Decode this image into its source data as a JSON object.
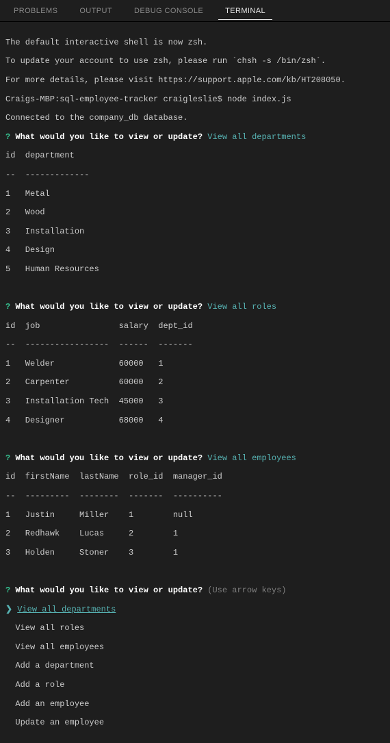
{
  "tabs": {
    "problems": "PROBLEMS",
    "output": "OUTPUT",
    "debug": "DEBUG CONSOLE",
    "terminal": "TERMINAL"
  },
  "intro": {
    "l1": "The default interactive shell is now zsh.",
    "l2a": "To update your account to use zsh, please run ",
    "l2cmd": "`chsh -s /bin/zsh`",
    "l2b": ".",
    "l3a": "For more details, please visit ",
    "l3url": "https://support.apple.com/kb/HT208050",
    "l3b": ".",
    "prompt": "Craigs-MBP:sql-employee-tracker craigleslie$ node index.js",
    "connected": "Connected to the company_db database."
  },
  "prompts": {
    "qmark": "?",
    "question": "What would you like to view or update?",
    "hint": "(Use arrow keys)",
    "caret": "❯"
  },
  "answers": {
    "depts": "View all departments",
    "roles": "View all roles",
    "emps": "View all employees"
  },
  "dept_table": {
    "header": "id  department",
    "sep": "--  -------------",
    "rows": [
      "1   Metal",
      "2   Wood",
      "3   Installation",
      "4   Design",
      "5   Human Resources"
    ]
  },
  "role_table": {
    "header": "id  job                salary  dept_id",
    "sep": "--  -----------------  ------  -------",
    "rows": [
      "1   Welder             60000   1",
      "2   Carpenter          60000   2",
      "3   Installation Tech  45000   3",
      "4   Designer           68000   4"
    ]
  },
  "emp_table": {
    "header": "id  firstName  lastName  role_id  manager_id",
    "sep": "--  ---------  --------  -------  ----------",
    "rows": [
      "1   Justin     Miller    1        null",
      "2   Redhawk    Lucas     2        1",
      "3   Holden     Stoner    3        1"
    ]
  },
  "menu": {
    "selected": "View all departments",
    "opts": [
      "View all roles",
      "View all employees",
      "Add a department",
      "Add a role",
      "Add an employee",
      "Update an employee"
    ]
  }
}
